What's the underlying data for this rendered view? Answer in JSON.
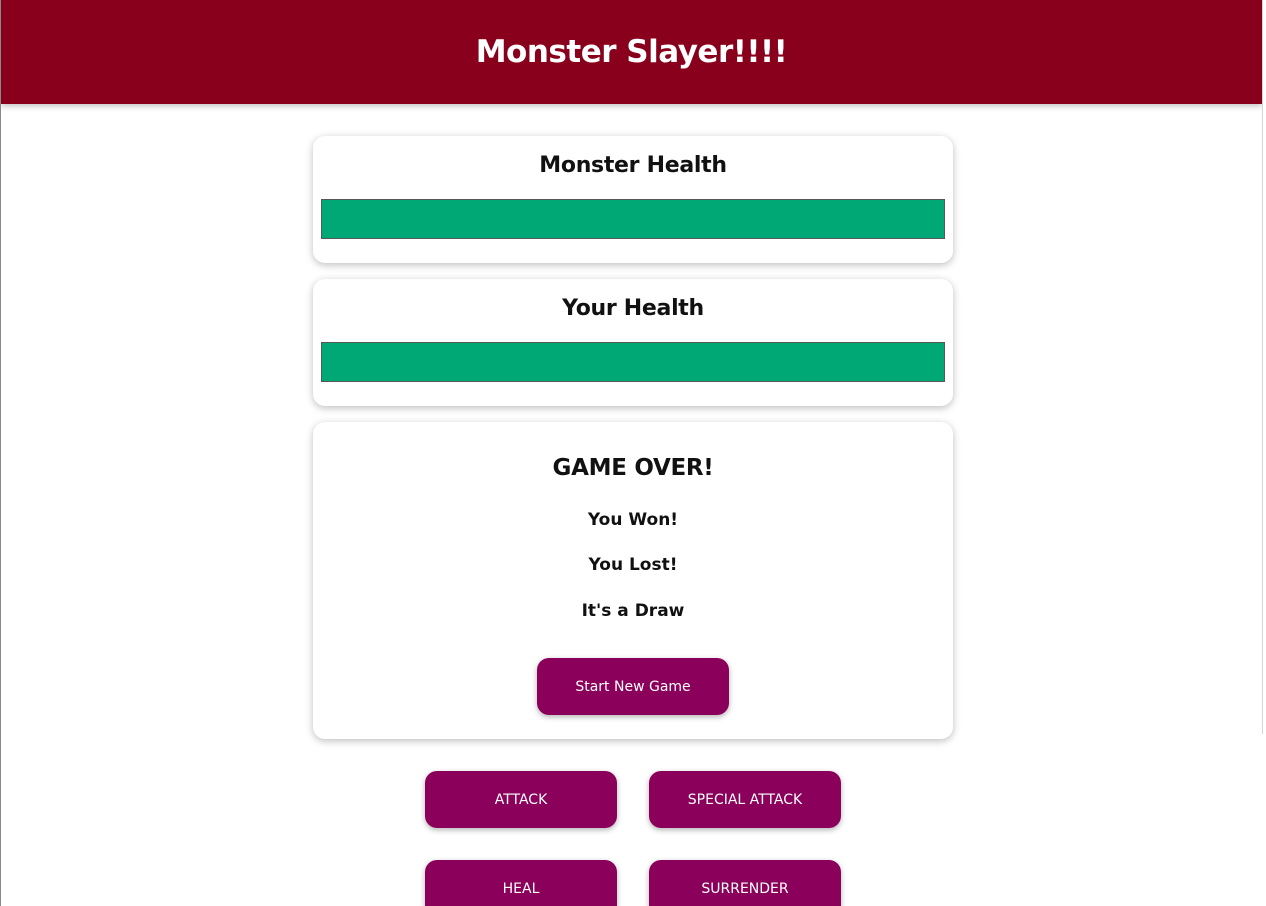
{
  "header": {
    "title": "Monster Slayer!!!!"
  },
  "monster": {
    "title": "Monster Health",
    "health_percent": 100
  },
  "player": {
    "title": "Your Health",
    "health_percent": 100
  },
  "result": {
    "title": "GAME OVER!",
    "won": "You Won!",
    "lost": "You Lost!",
    "draw": "It's a Draw",
    "new_game_label": "Start New Game"
  },
  "controls": {
    "attack": "ATTACK",
    "special_attack": "SPECIAL ATTACK",
    "heal": "HEAL",
    "surrender": "SURRENDER"
  },
  "colors": {
    "header": "#88001b",
    "button": "#8a005a",
    "health_fill": "#00a876"
  }
}
